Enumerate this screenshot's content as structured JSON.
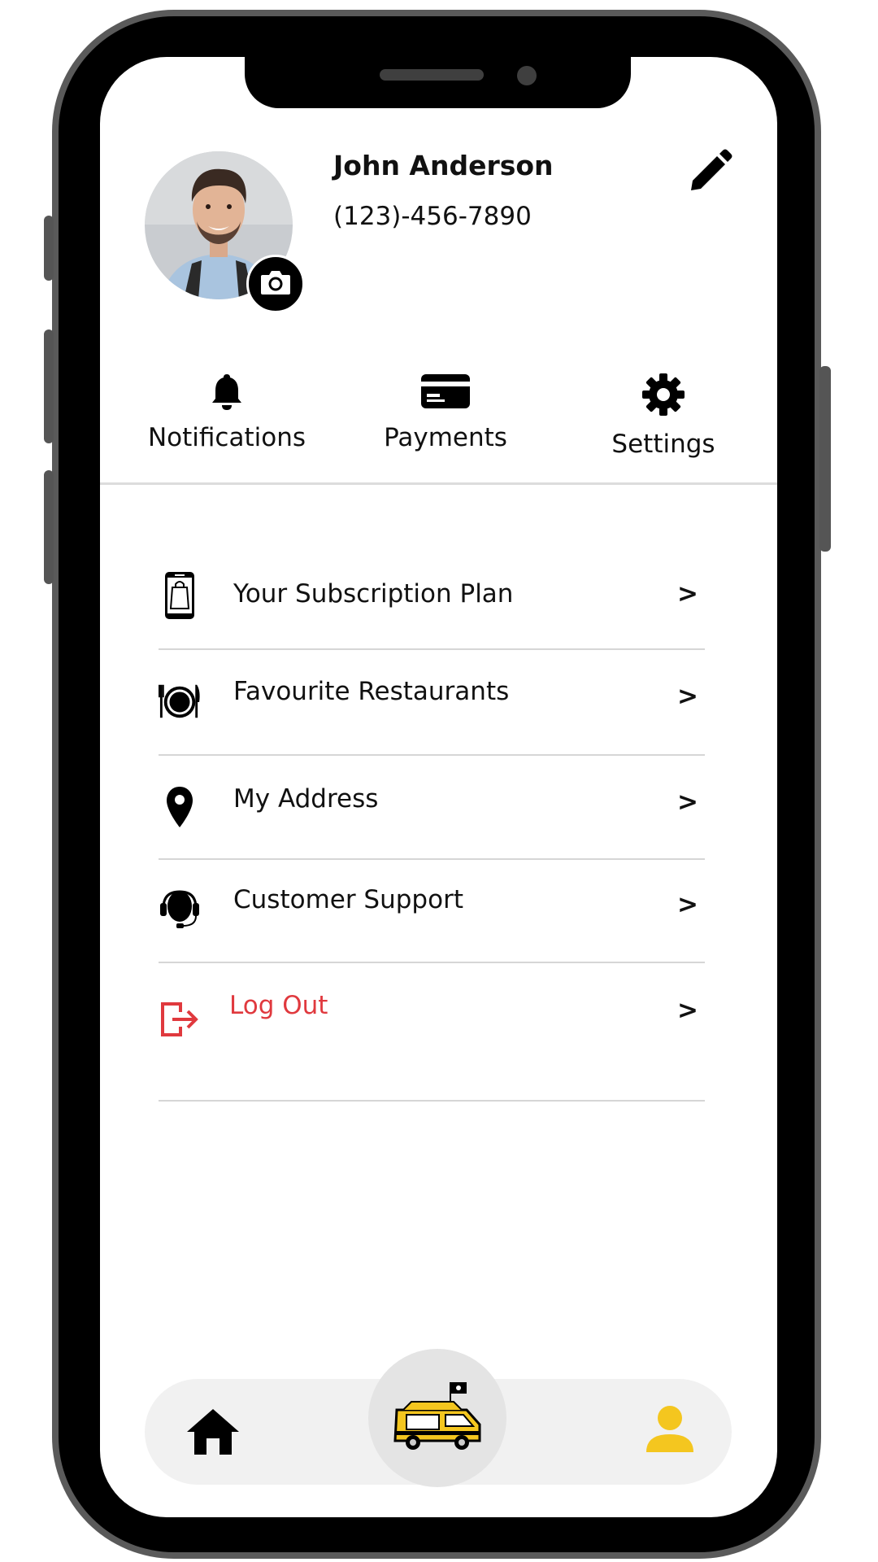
{
  "profile": {
    "name": "John Anderson",
    "phone": "(123)-456-7890",
    "avatar_icon": "user-photo",
    "camera_icon": "camera-icon",
    "edit_icon": "pencil-icon"
  },
  "quick_actions": [
    {
      "label": "Notifications",
      "icon": "bell-icon"
    },
    {
      "label": "Payments",
      "icon": "credit-card-icon"
    },
    {
      "label": "Settings",
      "icon": "gear-icon"
    }
  ],
  "menu": [
    {
      "label": "Your Subscription Plan",
      "icon": "phone-shopping-bag-icon",
      "chevron": ">"
    },
    {
      "label": "Favourite Restaurants",
      "icon": "plate-cutlery-icon",
      "chevron": ">"
    },
    {
      "label": "My Address",
      "icon": "map-pin-icon",
      "chevron": ">"
    },
    {
      "label": "Customer Support",
      "icon": "headset-icon",
      "chevron": ">"
    },
    {
      "label": "Log Out",
      "icon": "logout-icon",
      "chevron": ">"
    }
  ],
  "bottom_nav": {
    "home_icon": "home-icon",
    "center_icon": "food-truck-icon",
    "profile_icon": "user-icon"
  },
  "colors": {
    "accent": "#f4c61f",
    "logout": "#e0393e",
    "text": "#111111",
    "nav_bg": "#f1f1f1"
  }
}
